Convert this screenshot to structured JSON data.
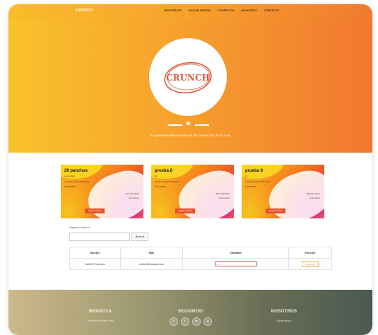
{
  "nav": {
    "brand": "CRUNCH",
    "links": [
      "REGISTRATE",
      "INICIAR SESIÓN",
      "COMERCIOS",
      "NOSOTROS",
      "CONTACTO"
    ]
  },
  "hero": {
    "logo_text": "CRUNCH",
    "tagline": "El ganam de descuentos en los comercios de la zona"
  },
  "cards": [
    {
      "title": "29 panchos",
      "line1": "Lorem ipsum",
      "line2": "Cuenta de cuenta: 2020-10-10",
      "line3": "Cost: $76500",
      "right1": "Mas informacion",
      "right2": "Lorem ipsum",
      "button": "Agregar carrito"
    },
    {
      "title": "prueba 8",
      "line1": "23",
      "line2": "Cuenta de cuenta: 2020-10-10",
      "line3": "Cost: $76500",
      "right1": "Mas informacion",
      "right2": "Lorem ipsum",
      "button": "Agregar carrito"
    },
    {
      "title": "prueba 9",
      "line1": "10",
      "line2": "Cuenta de cuenta: 2020-10-10",
      "line3": "Cost: $76500",
      "right1": "Mas informacion",
      "right2": "Lorem ipsum",
      "button": "Agregar carrito"
    }
  ],
  "search": {
    "label": "Ingresar usuario",
    "input_value": "",
    "button": "Buscar"
  },
  "table": {
    "headers": [
      "Nombre",
      "Mail",
      "Cantidad",
      "Función"
    ],
    "rows": [
      {
        "nombre": "Dallo El Tommyo",
        "mail": "clientc@hotmail.com",
        "cantidad": "1",
        "funcion": "Confirmar"
      }
    ]
  },
  "footer": {
    "col1_head": "MENDOZA",
    "col1_text": "Avenida Siempre Viva",
    "col2_head": "SEGUINOS!",
    "col3_head": "NOSOTROS",
    "col3_text": "Marca grupo",
    "social_icons": [
      "facebook-icon",
      "twitter-icon",
      "linkedin-icon",
      "instagram-icon"
    ]
  }
}
